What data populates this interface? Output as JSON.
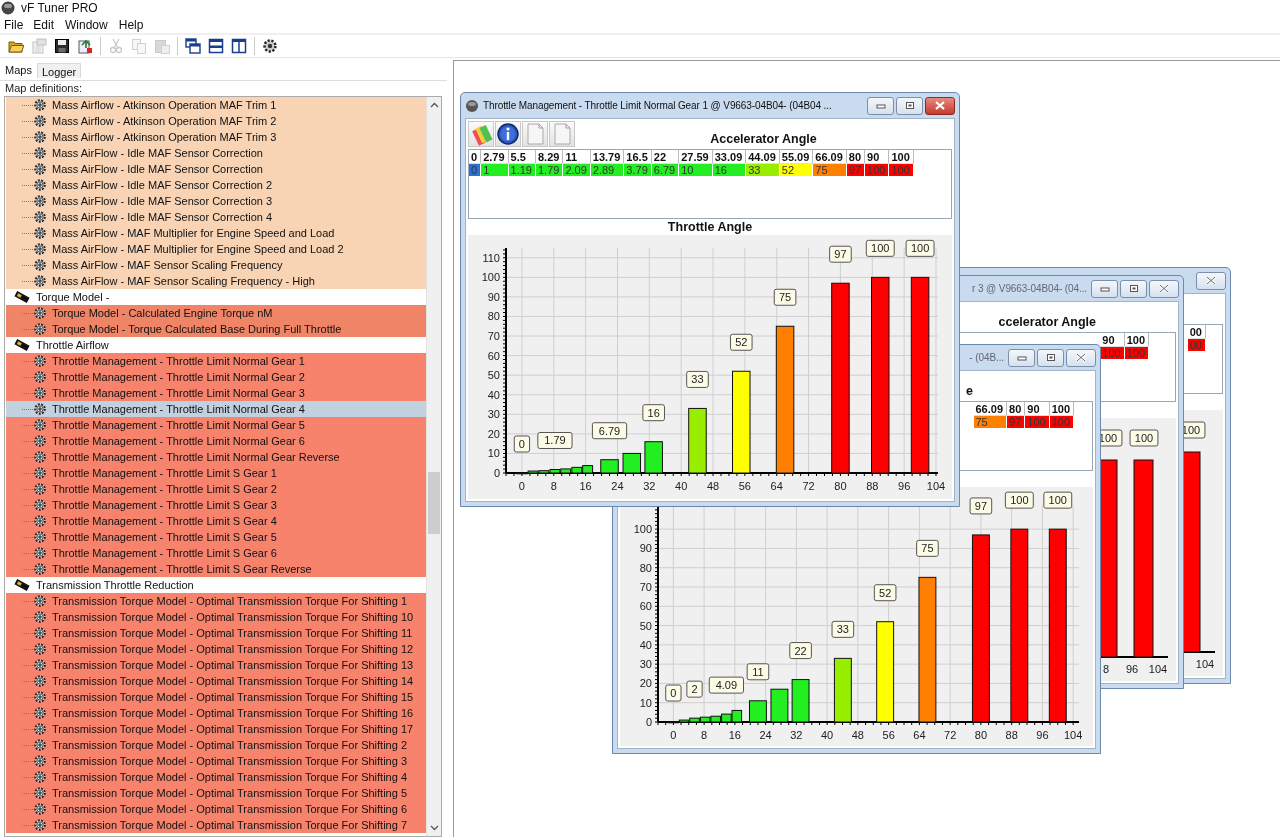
{
  "window": {
    "title": "vF Tuner PRO"
  },
  "menu": [
    "File",
    "Edit",
    "Window",
    "Help"
  ],
  "toolbar": [
    {
      "kind": "folder",
      "disabled": false
    },
    {
      "kind": "properties",
      "disabled": true
    },
    {
      "kind": "save",
      "disabled": false
    },
    {
      "kind": "export",
      "disabled": false
    },
    {
      "kind": "separator"
    },
    {
      "kind": "cut",
      "disabled": true
    },
    {
      "kind": "copy",
      "disabled": true
    },
    {
      "kind": "paste",
      "disabled": true
    },
    {
      "kind": "separator"
    },
    {
      "kind": "cascade",
      "disabled": false
    },
    {
      "kind": "tile-horizontal",
      "disabled": false
    },
    {
      "kind": "tile-vertical",
      "disabled": false
    },
    {
      "kind": "separator"
    },
    {
      "kind": "gear",
      "disabled": false
    }
  ],
  "tabs": [
    {
      "label": "Maps",
      "selected": true
    },
    {
      "label": "Logger",
      "selected": false
    }
  ],
  "map_definitions": {
    "label": "Map definitions:",
    "groups": [
      {
        "color": "#f8d3b4",
        "children": [
          {
            "label": "Mass Airflow - Atkinson Operation MAF Trim 1",
            "selected": false
          },
          {
            "label": "Mass Airflow - Atkinson Operation MAF Trim 2",
            "selected": false
          },
          {
            "label": "Mass Airflow - Atkinson Operation MAF Trim 3",
            "selected": false
          },
          {
            "label": "Mass AirFlow - Idle MAF Sensor Correction",
            "selected": false
          },
          {
            "label": "Mass AirFlow - Idle MAF Sensor Correction",
            "selected": false
          },
          {
            "label": "Mass AirFlow - Idle MAF Sensor Correction 2",
            "selected": false
          },
          {
            "label": "Mass AirFlow - Idle MAF Sensor Correction 3",
            "selected": false
          },
          {
            "label": "Mass AirFlow - Idle MAF Sensor Correction 4",
            "selected": false
          },
          {
            "label": "Mass AirFlow - MAF Multiplier for Engine Speed and Load",
            "selected": false
          },
          {
            "label": "Mass AirFlow - MAF Multiplier for Engine Speed and Load 2",
            "selected": false
          },
          {
            "label": "Mass AirFlow - MAF Sensor Scaling Frequency",
            "selected": false
          },
          {
            "label": "Mass AirFlow - MAF Sensor Scaling Frequency - High",
            "selected": false
          }
        ]
      },
      {
        "label": "Torque Model -",
        "color": "#ef8566",
        "children": [
          {
            "label": "Torque Model - Calculated Engine Torque nM",
            "selected": false
          },
          {
            "label": "Torque Model - Torque Calculated Base During Full Throttle",
            "selected": false
          }
        ]
      },
      {
        "label": "Throttle Airflow",
        "color": "#f7836c",
        "children": [
          {
            "label": "Throttle Management - Throttle Limit Normal Gear 1",
            "selected": false
          },
          {
            "label": "Throttle Management - Throttle Limit Normal Gear 2",
            "selected": false
          },
          {
            "label": "Throttle Management - Throttle Limit Normal Gear 3",
            "selected": false
          },
          {
            "label": "Throttle Management - Throttle Limit Normal Gear 4",
            "selected": true
          },
          {
            "label": "Throttle Management - Throttle Limit Normal Gear 5",
            "selected": false
          },
          {
            "label": "Throttle Management - Throttle Limit Normal Gear 6",
            "selected": false
          },
          {
            "label": "Throttle Management - Throttle Limit Normal Gear Reverse",
            "selected": false
          },
          {
            "label": "Throttle Management - Throttle Limit S Gear 1",
            "selected": false
          },
          {
            "label": "Throttle Management - Throttle Limit S Gear 2",
            "selected": false
          },
          {
            "label": "Throttle Management - Throttle Limit S Gear 3",
            "selected": false
          },
          {
            "label": "Throttle Management - Throttle Limit S Gear 4",
            "selected": false
          },
          {
            "label": "Throttle Management - Throttle Limit S Gear 5",
            "selected": false
          },
          {
            "label": "Throttle Management - Throttle Limit S Gear 6",
            "selected": false
          },
          {
            "label": "Throttle Management - Throttle Limit S Gear Reverse",
            "selected": false
          }
        ]
      },
      {
        "label": "Transmission Throttle Reduction",
        "color": "#f7836c",
        "children": [
          {
            "label": "Transmission Torque Model - Optimal Transmission Torque For Shifting 1",
            "selected": false
          },
          {
            "label": "Transmission Torque Model - Optimal Transmission Torque For Shifting 10",
            "selected": false
          },
          {
            "label": "Transmission Torque Model - Optimal Transmission Torque For Shifting 11",
            "selected": false
          },
          {
            "label": "Transmission Torque Model - Optimal Transmission Torque For Shifting 12",
            "selected": false
          },
          {
            "label": "Transmission Torque Model - Optimal Transmission Torque For Shifting 13",
            "selected": false
          },
          {
            "label": "Transmission Torque Model - Optimal Transmission Torque For Shifting 14",
            "selected": false
          },
          {
            "label": "Transmission Torque Model - Optimal Transmission Torque For Shifting 15",
            "selected": false
          },
          {
            "label": "Transmission Torque Model - Optimal Transmission Torque For Shifting 16",
            "selected": false
          },
          {
            "label": "Transmission Torque Model - Optimal Transmission Torque For Shifting 17",
            "selected": false
          },
          {
            "label": "Transmission Torque Model - Optimal Transmission Torque For Shifting 2",
            "selected": false
          },
          {
            "label": "Transmission Torque Model - Optimal Transmission Torque For Shifting 3",
            "selected": false
          },
          {
            "label": "Transmission Torque Model - Optimal Transmission Torque For Shifting 4",
            "selected": false
          },
          {
            "label": "Transmission Torque Model - Optimal Transmission Torque For Shifting 5",
            "selected": false
          },
          {
            "label": "Transmission Torque Model - Optimal Transmission Torque For Shifting 6",
            "selected": false
          },
          {
            "label": "Transmission Torque Model - Optimal Transmission Torque For Shifting 7",
            "selected": false
          }
        ]
      }
    ]
  },
  "windows": [
    {
      "title": "Throttle Management - Throttle Limit Normal Gear 1 @ V9663-04B04- (04B04 ...",
      "active": true,
      "tools": [
        {
          "kind": "palette"
        },
        {
          "kind": "info"
        },
        {
          "kind": "page"
        },
        {
          "kind": "page"
        }
      ],
      "table_title": "Accelerator Angle",
      "columns": [
        "0",
        "2.79",
        "5.5",
        "8.29",
        "11",
        "13.79",
        "16.5",
        "22",
        "27.59",
        "33.09",
        "44.09",
        "55.09",
        "66.09",
        "80",
        "90",
        "100"
      ],
      "cells": [
        {
          "text": "0",
          "color": "#2a72d0"
        },
        {
          "text": "1",
          "color": "#22ee22"
        },
        {
          "text": "1.19",
          "color": "#22ee22"
        },
        {
          "text": "1.79",
          "color": "#22ee22"
        },
        {
          "text": "2.09",
          "color": "#22ee22"
        },
        {
          "text": "2.89",
          "color": "#22ee22"
        },
        {
          "text": "3.79",
          "color": "#22ee22"
        },
        {
          "text": "6.79",
          "color": "#22ee22"
        },
        {
          "text": "10",
          "color": "#22ee22"
        },
        {
          "text": "16",
          "color": "#22ee22"
        },
        {
          "text": "33",
          "color": "#99ee00"
        },
        {
          "text": "52",
          "color": "#ffff00"
        },
        {
          "text": "75",
          "color": "#ff8000"
        },
        {
          "text": "97",
          "color": "#ff0000"
        },
        {
          "text": "100",
          "color": "#ff0000"
        },
        {
          "text": "100",
          "color": "#ff0000"
        }
      ],
      "chart_data": {
        "type": "bar",
        "title": "Throttle Angle",
        "x": [
          0,
          2.79,
          5.5,
          8.29,
          11,
          13.79,
          16.5,
          22,
          27.59,
          33.09,
          44.09,
          55.09,
          66.09,
          80,
          90,
          100
        ],
        "series": [
          {
            "values": [
              0,
              1,
              1.19,
              1.79,
              2.09,
              2.89,
              3.79,
              6.79,
              10,
              16,
              33,
              52,
              75,
              97,
              100,
              100
            ],
            "colors": [
              "#2a72d0",
              "#22ee22",
              "#22ee22",
              "#22ee22",
              "#22ee22",
              "#22ee22",
              "#22ee22",
              "#22ee22",
              "#22ee22",
              "#22ee22",
              "#99ee00",
              "#ffff00",
              "#ff8000",
              "#ff0000",
              "#ff0000",
              "#ff0000"
            ]
          }
        ],
        "grid": true,
        "xlim": [
          -4,
          104
        ],
        "ylim": [
          0,
          115
        ],
        "xticks": [
          0,
          8,
          16,
          24,
          32,
          40,
          48,
          56,
          64,
          72,
          80,
          88,
          96,
          104
        ],
        "yticks": [
          0,
          10,
          20,
          30,
          40,
          50,
          60,
          70,
          80,
          90,
          100,
          110
        ],
        "value_labels": [
          "0",
          null,
          null,
          "1.79",
          null,
          null,
          null,
          "6.79",
          null,
          "16",
          "33",
          "52",
          "75",
          "97",
          "100",
          "100"
        ]
      }
    },
    {
      "title": "- (04B...",
      "active": false,
      "table_title": "e",
      "columns": [
        "66.09",
        "80",
        "90",
        "100"
      ],
      "cells": [
        {
          "text": "75",
          "color": "#ff8000"
        },
        {
          "text": "97",
          "color": "#ff0000"
        },
        {
          "text": "100",
          "color": "#ff0000"
        },
        {
          "text": "100",
          "color": "#ff0000"
        }
      ],
      "chart_data": {
        "type": "bar",
        "x": [
          0,
          2.79,
          5.5,
          8.29,
          11,
          13.79,
          16.5,
          22,
          27.59,
          33.09,
          44.09,
          55.09,
          66.09,
          80,
          90,
          100
        ],
        "series": [
          {
            "values": [
              0,
              1,
              2,
              2.5,
              3,
              4.09,
              6,
              11,
              17,
              22,
              33,
              52,
              75,
              97,
              100,
              100
            ],
            "colors": [
              "#2a72d0",
              "#22ee22",
              "#22ee22",
              "#22ee22",
              "#22ee22",
              "#22ee22",
              "#22ee22",
              "#22ee22",
              "#22ee22",
              "#22ee22",
              "#99ee00",
              "#ffff00",
              "#ff8000",
              "#ff0000",
              "#ff0000",
              "#ff0000"
            ]
          }
        ],
        "grid": true,
        "xlim": [
          -4,
          105
        ],
        "ylim": [
          0,
          112
        ],
        "xticks": [
          0,
          8,
          16,
          24,
          32,
          40,
          48,
          56,
          64,
          72,
          80,
          88,
          96,
          104
        ],
        "yticks": [
          0,
          10,
          20,
          30,
          40,
          50,
          60,
          70,
          80,
          90,
          100
        ],
        "value_labels": [
          "0",
          null,
          "2",
          null,
          null,
          "4.09",
          null,
          "11",
          null,
          "22",
          "33",
          "52",
          "75",
          "97",
          "100",
          "100"
        ]
      }
    },
    {
      "title": "r 3 @ V9663-04B04- (04...",
      "active": false,
      "table_title": "ccelerator Angle",
      "columns": [
        "90",
        "100"
      ],
      "cells": [
        {
          "text": "100",
          "color": "#ff0000"
        },
        {
          "text": "100",
          "color": "#ff0000"
        }
      ],
      "chart_fragment": {
        "value_labels": [
          "100",
          "100"
        ],
        "tick_labels": [
          "8",
          "96",
          "104"
        ],
        "color": "#ff0000"
      }
    },
    {
      "active": false,
      "columns": [
        "00"
      ],
      "cells": [
        {
          "text": "00",
          "color": "#ff0000"
        }
      ],
      "chart_fragment": {
        "value_labels": [
          "100"
        ],
        "tick_labels": [
          "104"
        ],
        "color": "#ff0000"
      }
    }
  ]
}
